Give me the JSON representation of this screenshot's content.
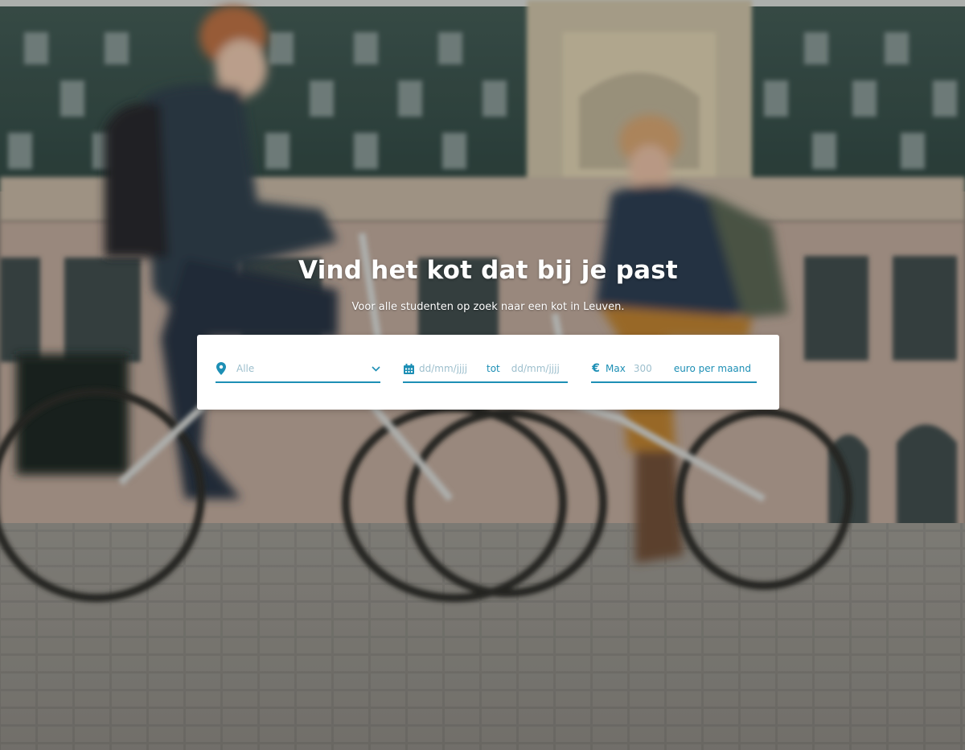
{
  "hero": {
    "title": "Vind het kot dat bij je past",
    "subtitle": "Voor alle studenten op zoek naar een kot in Leuven."
  },
  "search": {
    "location": {
      "icon": "map-pin-icon",
      "value": "Alle",
      "chevron": "chevron-down-icon"
    },
    "dates": {
      "icon": "calendar-icon",
      "from_placeholder": "dd/mm/jjjj",
      "separator": "tot",
      "to_placeholder": "dd/mm/jjjj"
    },
    "price": {
      "icon": "euro-icon",
      "symbol": "€",
      "label": "Max",
      "placeholder": "300",
      "unit": "euro per maand"
    }
  },
  "colors": {
    "accent": "#1d8fb5",
    "placeholder": "#9dbfcd",
    "panel": "#ffffff"
  }
}
